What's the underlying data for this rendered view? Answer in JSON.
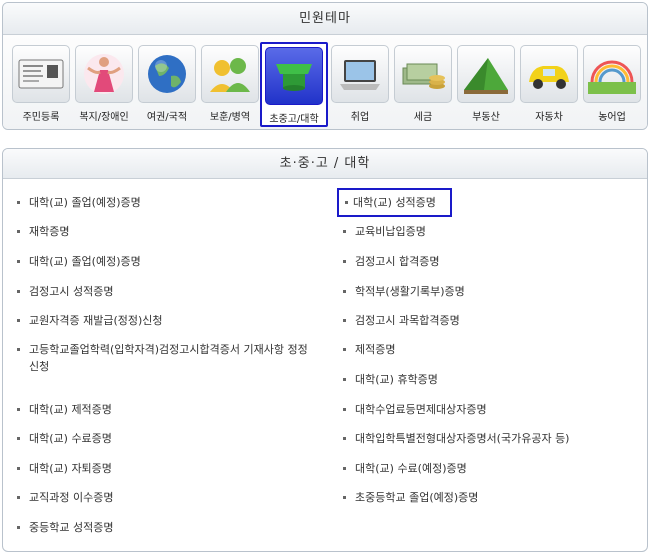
{
  "theme_panel": {
    "title": "민원테마",
    "items": [
      {
        "label": "주민등록",
        "icon": "id-card-icon"
      },
      {
        "label": "복지/장애인",
        "icon": "welfare-icon"
      },
      {
        "label": "여권/국적",
        "icon": "globe-icon"
      },
      {
        "label": "보훈/병역",
        "icon": "veterans-icon"
      },
      {
        "label": "초중고/대학",
        "icon": "graduation-cap-icon",
        "selected": true
      },
      {
        "label": "취업",
        "icon": "laptop-icon"
      },
      {
        "label": "세금",
        "icon": "money-icon"
      },
      {
        "label": "부동산",
        "icon": "land-icon"
      },
      {
        "label": "자동차",
        "icon": "car-icon"
      },
      {
        "label": "농어업",
        "icon": "rainbow-field-icon"
      }
    ]
  },
  "list_panel": {
    "title": "초·중·고 / 대학",
    "left": [
      "대학(교) 졸업(예정)증명",
      "재학증명",
      "대학(교) 졸업(예정)증명",
      "검정고시 성적증명",
      "교원자격증 재발급(정정)신청",
      "고등학교졸업학력(입학자격)검정고시합격증서 기재사항 정정신청",
      "대학(교) 제적증명",
      "대학(교) 수료증명",
      "대학(교) 자퇴증명",
      "교직과정 이수증명",
      "중등학교 성적증명"
    ],
    "right": [
      "대학(교) 성적증명",
      "교육비납입증명",
      "검정고시 합격증명",
      "학적부(생활기록부)증명",
      "검정고시 과목합격증명",
      "제적증명",
      "대학(교) 휴학증명",
      "대학수업료등면제대상자증명",
      "대학입학특별전형대상자증명서(국가유공자 등)",
      "대학(교) 수료(예정)증명",
      "초중등학교 졸업(예정)증명"
    ],
    "highlighted": "대학(교) 성적증명"
  },
  "colors": {
    "selection_border": "#1a1ac9",
    "panel_border": "#b9c2cc",
    "header_bg": "#e7ebef"
  }
}
